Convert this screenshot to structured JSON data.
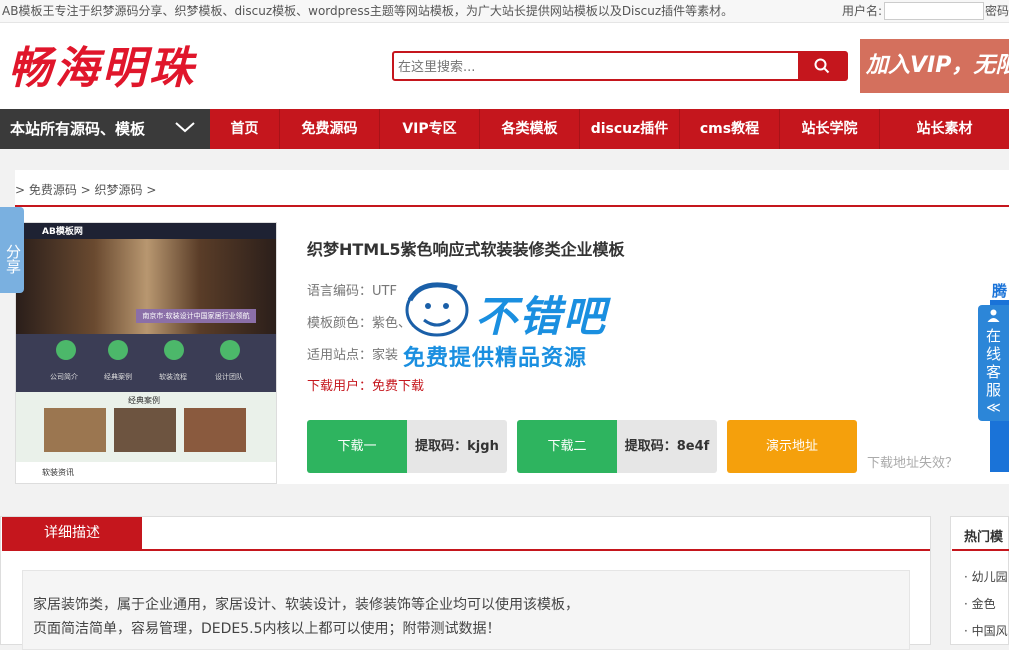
{
  "topbar": {
    "notice": "AB模板王专注于织梦源码分享、织梦模板、discuz模板、wordpress主题等网站模板，为广大站长提供网站模板以及Discuz插件等素材。",
    "username_label": "用户名:",
    "password_label": "密码"
  },
  "header": {
    "logo": "畅海明珠",
    "search_placeholder": "在这里搜索...",
    "vip_banner": "加入VIP，无限"
  },
  "nav": {
    "all_label": "本站所有源码、模板",
    "items": [
      "首页",
      "免费源码",
      "VIP专区",
      "各类模板",
      "discuz插件",
      "cms教程",
      "站长学院",
      "站长素材"
    ]
  },
  "breadcrumb": "> 免费源码 > 织梦源码 >",
  "share": "分享",
  "product": {
    "title": "织梦HTML5紫色响应式软装装修类企业模板",
    "encoding": "语言编码：UTF",
    "color": "模板颜色：紫色、灰色",
    "site": "适用站点：家装",
    "download_user": "下载用户：免费下载",
    "btn1_label": "下载一",
    "btn1_code": "提取码：kjgh",
    "btn2_label": "下载二",
    "btn2_code": "提取码：8e4f",
    "demo_label": "演示地址",
    "invalid_link": "下载地址失效？"
  },
  "thumbnail": {
    "logo": "AB模板网",
    "banner_text": "南京市·软装设计中国家居行业领航",
    "icons": [
      "公司简介",
      "经典案例",
      "软装流程",
      "设计团队"
    ],
    "cases_title": "经典案例",
    "news_title": "软装资讯"
  },
  "watermark": {
    "title": "不错吧",
    "subtitle": "免费提供精品资源"
  },
  "side": {
    "right_ad": "腾",
    "service": "在线客服"
  },
  "description": {
    "tab": "详细描述",
    "line1": "家居装饰类，属于企业通用，家居设计、软装设计，装修装饰等企业均可以使用该模板，",
    "line2": "页面简洁简单，容易管理，DEDE5.5内核以上都可以使用；附带测试数据！"
  },
  "hot": {
    "title": "热门模",
    "items": [
      "· 幼儿园",
      "· 金色",
      "· 中国风"
    ]
  },
  "colors": {
    "brand_red": "#c5161d",
    "green": "#2eb45f",
    "orange": "#f5a00c",
    "watermark_blue": "#1a8fe0"
  }
}
